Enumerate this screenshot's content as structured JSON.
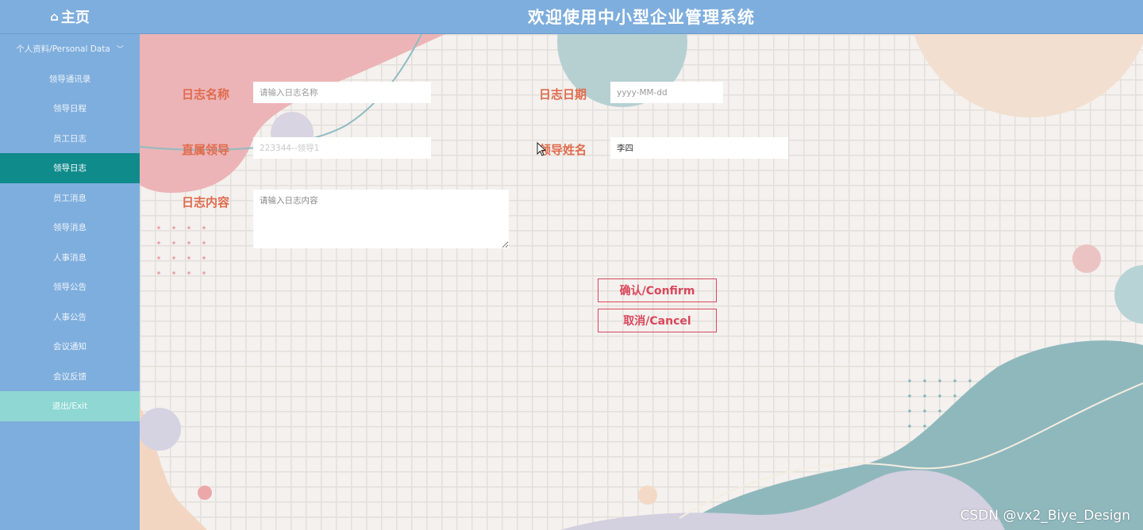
{
  "header": {
    "home_label": "主页",
    "home_icon": "home-icon",
    "title": "欢迎使用中小型企业管理系统"
  },
  "sidebar": {
    "items": [
      {
        "label": "个人资料/Personal Data"
      },
      {
        "label": "领导通讯录"
      },
      {
        "label": "领导日程"
      },
      {
        "label": "员工日志"
      },
      {
        "label": "领导日志"
      },
      {
        "label": "员工消息"
      },
      {
        "label": "领导消息"
      },
      {
        "label": "人事消息"
      },
      {
        "label": "领导公告"
      },
      {
        "label": "人事公告"
      },
      {
        "label": "会议通知"
      },
      {
        "label": "会议反馈"
      },
      {
        "label": "退出/Exit"
      }
    ],
    "active_index": 4
  },
  "form": {
    "log_name": {
      "label": "日志名称",
      "placeholder": "请输入日志名称",
      "value": ""
    },
    "log_date": {
      "label": "日志日期",
      "placeholder": "yyyy-MM-dd",
      "value": ""
    },
    "leader": {
      "label": "直属领导",
      "value": "223344--领导1"
    },
    "leader_name": {
      "label": "领导姓名",
      "value": "李四"
    },
    "log_content": {
      "label": "日志内容",
      "placeholder": "请输入日志内容",
      "value": ""
    },
    "confirm_label": "确认/Confirm",
    "cancel_label": "取消/Cancel"
  },
  "watermark": "CSDN @vx2_Biye_Design",
  "colors": {
    "header_bg": "#7eaedd",
    "active_item": "#108b8c",
    "exit_item": "#8ed7d2",
    "label_text": "#e06b4d",
    "button_accent": "#d9475c"
  }
}
